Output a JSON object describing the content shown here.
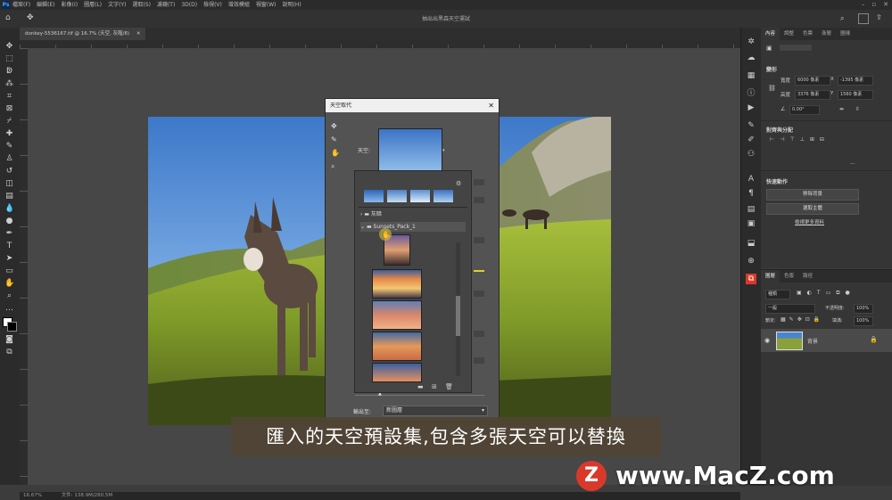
{
  "app": {
    "logo": "Ps",
    "menus": [
      "檔案(F)",
      "編輯(E)",
      "影像(I)",
      "圖層(L)",
      "文字(Y)",
      "選取(S)",
      "濾鏡(T)",
      "3D(D)",
      "檢視(V)",
      "增效模組",
      "視窗(W)",
      "說明(H)"
    ],
    "document_title": "抽出出黑森天空運試",
    "tab_label": "donkey-5536167.tif @ 16.7% (天空, 灰階/8)",
    "status_zoom": "16.67%",
    "status_doc": "文件: 138.9M/280.5M"
  },
  "sky_dialog": {
    "title": "天空取代",
    "sky_label": "天空:",
    "folder_fog": "灰暗",
    "folder_sunsets": "Sunsets_Pack_1",
    "output_label": "輸出至:",
    "output_value": "新圖層"
  },
  "properties_panel": {
    "tabs": [
      "內容",
      "調整",
      "色票",
      "漸層",
      "圖樣"
    ],
    "section_transform": "變形",
    "width_label": "寬度",
    "width_value": "6000 像素",
    "height_label": "高度",
    "height_value": "3376 像素",
    "x_label": "X",
    "x_value": "-1395 像素",
    "y_label": "Y",
    "y_value": "1560 像素",
    "angle_value": "0.00°",
    "section_align": "對齊與分配",
    "section_quick": "快速動作",
    "btn_1": "移除背景",
    "btn_2": "選取主體",
    "link_more": "檢視更多資料"
  },
  "layers_panel": {
    "tabs": [
      "圖層",
      "色版",
      "路徑"
    ],
    "filter_label": "種類",
    "mode_label": "一般",
    "opacity_label": "不透明度:",
    "opacity_value": "100%",
    "lock_label": "鎖定:",
    "fill_label": "填滿:",
    "fill_value": "100%",
    "layer_name": "背景"
  },
  "caption": {
    "text": "匯入的天空預設集,包含多張天空可以替換"
  },
  "watermark": {
    "logo_letter": "Z",
    "text": "www.MacZ.com"
  },
  "colors": {
    "accent": "#e8c8a0",
    "watermark_red": "#d8392b",
    "sky_blue": "#4f8dd8"
  }
}
